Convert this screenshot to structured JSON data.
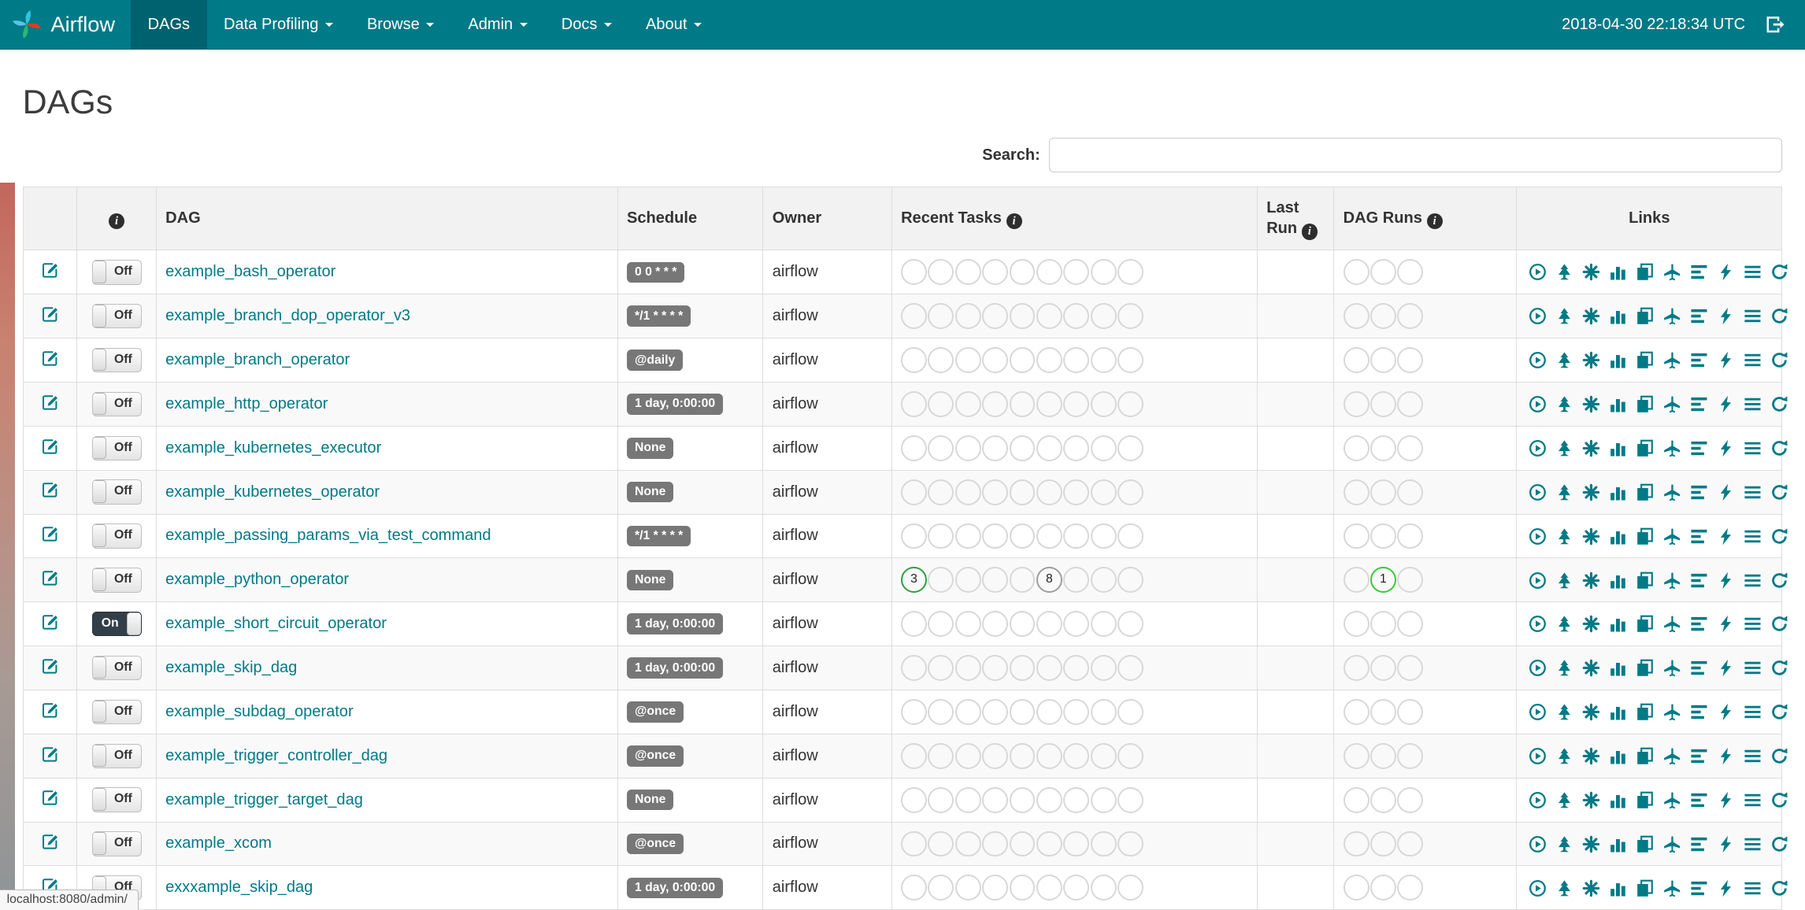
{
  "navbar": {
    "brand": "Airflow",
    "items": [
      {
        "label": "DAGs",
        "active": true,
        "dropdown": false
      },
      {
        "label": "Data Profiling",
        "active": false,
        "dropdown": true
      },
      {
        "label": "Browse",
        "active": false,
        "dropdown": true
      },
      {
        "label": "Admin",
        "active": false,
        "dropdown": true
      },
      {
        "label": "Docs",
        "active": false,
        "dropdown": true
      },
      {
        "label": "About",
        "active": false,
        "dropdown": true
      }
    ],
    "clock": "2018-04-30 22:18:34 UTC",
    "icons": {
      "logo": "airflow-pinwheel-logo",
      "logout": "sign-out-icon"
    }
  },
  "page": {
    "title": "DAGs"
  },
  "search": {
    "label": "Search:",
    "value": ""
  },
  "table": {
    "headers": {
      "info": "info-icon",
      "dag": "DAG",
      "schedule": "Schedule",
      "owner": "Owner",
      "recent_tasks": "Recent Tasks",
      "last_run": "Last Run",
      "dag_runs": "DAG Runs",
      "links": "Links"
    },
    "link_icons": [
      "trigger-dag-icon",
      "tree-view-icon",
      "graph-view-icon",
      "task-duration-icon",
      "task-tries-icon",
      "landing-times-icon",
      "gantt-view-icon",
      "code-view-icon",
      "log-icon",
      "refresh-icon"
    ],
    "recent_task_slots": 9,
    "dag_run_slots": 3,
    "rows": [
      {
        "toggle": "Off",
        "name": "example_bash_operator",
        "schedule": "0 0 * * *",
        "owner": "airflow",
        "recent_tasks": [],
        "dag_runs": []
      },
      {
        "toggle": "Off",
        "name": "example_branch_dop_operator_v3",
        "schedule": "*/1 * * * *",
        "owner": "airflow",
        "recent_tasks": [],
        "dag_runs": []
      },
      {
        "toggle": "Off",
        "name": "example_branch_operator",
        "schedule": "@daily",
        "owner": "airflow",
        "recent_tasks": [],
        "dag_runs": []
      },
      {
        "toggle": "Off",
        "name": "example_http_operator",
        "schedule": "1 day, 0:00:00",
        "owner": "airflow",
        "recent_tasks": [],
        "dag_runs": []
      },
      {
        "toggle": "Off",
        "name": "example_kubernetes_executor",
        "schedule": "None",
        "owner": "airflow",
        "recent_tasks": [],
        "dag_runs": []
      },
      {
        "toggle": "Off",
        "name": "example_kubernetes_operator",
        "schedule": "None",
        "owner": "airflow",
        "recent_tasks": [],
        "dag_runs": []
      },
      {
        "toggle": "Off",
        "name": "example_passing_params_via_test_command",
        "schedule": "*/1 * * * *",
        "owner": "airflow",
        "recent_tasks": [],
        "dag_runs": []
      },
      {
        "toggle": "Off",
        "name": "example_python_operator",
        "schedule": "None",
        "owner": "airflow",
        "recent_tasks": [
          {
            "slot": 0,
            "count": 3,
            "ring": "#2f9e44"
          },
          {
            "slot": 5,
            "count": 8,
            "ring": "#9d9d9d"
          }
        ],
        "dag_runs": [
          {
            "slot": 1,
            "count": 1,
            "ring": "#32cd32"
          }
        ]
      },
      {
        "toggle": "On",
        "name": "example_short_circuit_operator",
        "schedule": "1 day, 0:00:00",
        "owner": "airflow",
        "recent_tasks": [],
        "dag_runs": []
      },
      {
        "toggle": "Off",
        "name": "example_skip_dag",
        "schedule": "1 day, 0:00:00",
        "owner": "airflow",
        "recent_tasks": [],
        "dag_runs": []
      },
      {
        "toggle": "Off",
        "name": "example_subdag_operator",
        "schedule": "@once",
        "owner": "airflow",
        "recent_tasks": [],
        "dag_runs": []
      },
      {
        "toggle": "Off",
        "name": "example_trigger_controller_dag",
        "schedule": "@once",
        "owner": "airflow",
        "recent_tasks": [],
        "dag_runs": []
      },
      {
        "toggle": "Off",
        "name": "example_trigger_target_dag",
        "schedule": "None",
        "owner": "airflow",
        "recent_tasks": [],
        "dag_runs": []
      },
      {
        "toggle": "Off",
        "name": "example_xcom",
        "schedule": "@once",
        "owner": "airflow",
        "recent_tasks": [],
        "dag_runs": []
      },
      {
        "toggle": "Off",
        "name": "exxxample_skip_dag",
        "schedule": "1 day, 0:00:00",
        "owner": "airflow",
        "recent_tasks": [],
        "dag_runs": []
      }
    ]
  },
  "status_bar": {
    "text": "localhost:8080/admin/"
  },
  "colors": {
    "navbar": "#007A87",
    "navbar_active": "#00626e",
    "link_teal": "#007A87",
    "schedule_badge": "#777777",
    "toggle_on": "#333f48",
    "ring_default": "#d8d8d8",
    "ring_success_task": "#2f9e44",
    "ring_none_task": "#9d9d9d",
    "ring_success_run": "#32cd32"
  }
}
